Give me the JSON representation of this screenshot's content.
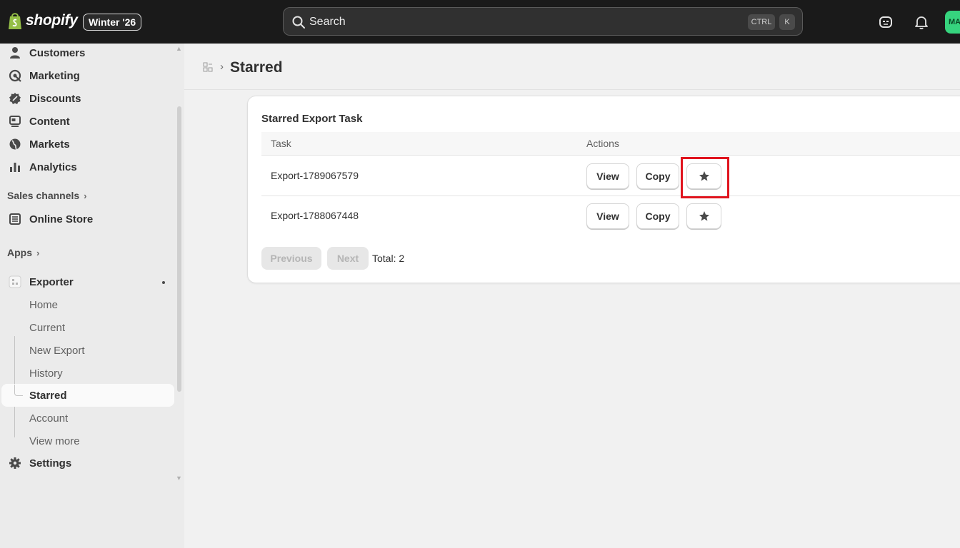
{
  "topbar": {
    "brand": "shopify",
    "edition_badge": "Winter '26",
    "search": {
      "placeholder": "Search",
      "shortcut_ctrl": "CTRL",
      "shortcut_key": "K"
    },
    "avatar_initials": "MA",
    "icons": [
      "shopify-bag-icon",
      "search-icon",
      "sidekick-icon",
      "bell-icon"
    ]
  },
  "sidebar": {
    "items": [
      {
        "label": "Customers",
        "icon": "person-icon"
      },
      {
        "label": "Marketing",
        "icon": "target-icon"
      },
      {
        "label": "Discounts",
        "icon": "discount-icon"
      },
      {
        "label": "Content",
        "icon": "content-icon"
      },
      {
        "label": "Markets",
        "icon": "globe-icon"
      },
      {
        "label": "Analytics",
        "icon": "bar-chart-icon"
      }
    ],
    "sales_channels_heading": "Sales channels",
    "online_store": "Online Store",
    "apps_heading": "Apps",
    "app": {
      "label": "Exporter",
      "sub_items": [
        "Home",
        "Current",
        "New Export",
        "History",
        "Starred",
        "Account",
        "View more"
      ],
      "active": "Starred"
    },
    "settings": "Settings"
  },
  "page": {
    "title": "Starred",
    "card_title": "Starred Export Task",
    "columns": [
      "Task",
      "Actions"
    ],
    "rows": [
      {
        "task": "Export-1789067579",
        "actions": [
          "View",
          "Copy"
        ]
      },
      {
        "task": "Export-1788067448",
        "actions": [
          "View",
          "Copy"
        ]
      }
    ],
    "pagination": {
      "previous": "Previous",
      "next": "Next",
      "total": "Total: 2"
    }
  },
  "colors": {
    "topbar_bg": "#1a1a1a",
    "sidebar_bg": "#ebebeb",
    "highlight_box": "#e0141e",
    "avatar_bg": "#36d47e"
  }
}
